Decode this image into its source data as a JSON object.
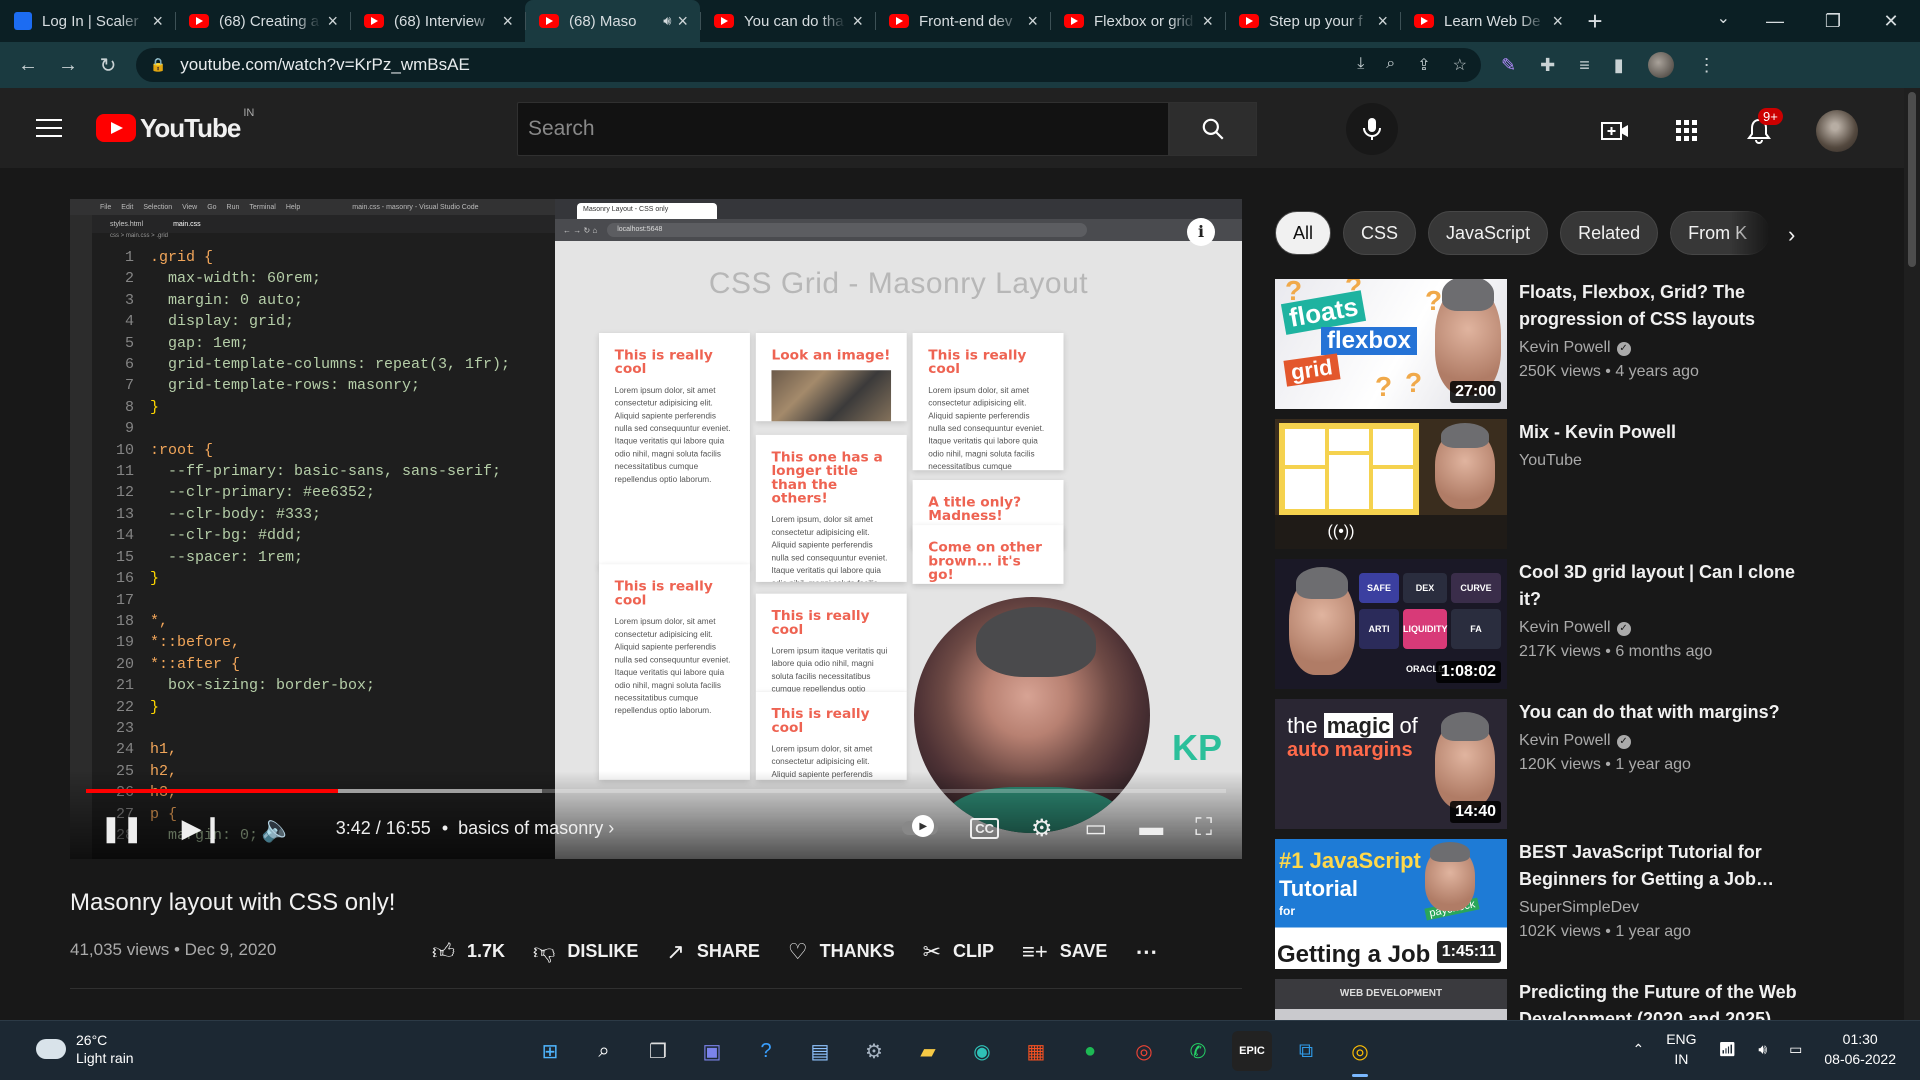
{
  "browser": {
    "tabs": [
      {
        "title": "Log In | Scaler",
        "icon": "scaler-icon",
        "active": false
      },
      {
        "title": "(68) Creating a",
        "icon": "youtube-icon",
        "active": false
      },
      {
        "title": "(68) Interview",
        "icon": "youtube-icon",
        "active": false
      },
      {
        "title": "(68) Maso",
        "icon": "youtube-icon",
        "active": true
      },
      {
        "title": "You can do tha",
        "icon": "youtube-icon",
        "active": false
      },
      {
        "title": "Front-end dev",
        "icon": "youtube-icon",
        "active": false
      },
      {
        "title": "Flexbox or grid",
        "icon": "youtube-icon",
        "active": false
      },
      {
        "title": "Step up your f",
        "icon": "youtube-icon",
        "active": false
      },
      {
        "title": "Learn Web De",
        "icon": "youtube-icon",
        "active": false
      }
    ],
    "url": "youtube.com/watch?v=KrPz_wmBsAE"
  },
  "youtube": {
    "logo_text": "YouTube",
    "region": "IN",
    "search_placeholder": "Search",
    "notification_count": "9+"
  },
  "player": {
    "current_time": "3:42",
    "duration": "16:55",
    "time_display": "3:42 / 16:55",
    "chapter": "basics of masonry",
    "progress_fraction": 0.221,
    "cc_label": "CC",
    "editor": {
      "window_title": "main.css - masonry - Visual Studio Code",
      "menu": [
        "File",
        "Edit",
        "Selection",
        "View",
        "Go",
        "Run",
        "Terminal",
        "Help"
      ],
      "open_files": [
        "styles.html",
        "main.css"
      ],
      "breadcrumb": "css > main.css > .grid",
      "code_lines": [
        ".grid {",
        "  max-width: 60rem;",
        "  margin: 0 auto;",
        "  display: grid;",
        "  gap: 1em;",
        "  grid-template-columns: repeat(3, 1fr);",
        "  grid-template-rows: masonry;",
        "}",
        "",
        ":root {",
        "  --ff-primary: basic-sans, sans-serif;",
        "  --clr-primary: #ee6352;",
        "  --clr-body: #333;",
        "  --clr-bg: #ddd;",
        "  --spacer: 1rem;",
        "}",
        "",
        "*,",
        "*::before,",
        "*::after {",
        "  box-sizing: border-box;",
        "}",
        "",
        "h1,",
        "h2,",
        "h3,",
        "p {",
        "  margin: 0;"
      ]
    },
    "demo": {
      "tab_title": "Masonry Layout - CSS only",
      "address": "localhost:5648",
      "heading": "CSS Grid - Masonry Layout",
      "cards": [
        {
          "title": "This is really cool",
          "body": "Lorem ipsum dolor, sit amet consectetur adipisicing elit. Aliquid sapiente perferendis nulla sed consequuntur eveniet. Itaque veritatis qui labore quia odio nihil, magni soluta facilis necessitatibus cumque repellendus optio laborum."
        },
        {
          "title": "Look an image!",
          "body": ""
        },
        {
          "title": "This is really cool",
          "body": "Lorem ipsum dolor, sit amet consectetur adipisicing elit. Aliquid sapiente perferendis nulla sed consequuntur eveniet. Itaque veritatis qui labore quia odio nihil, magni soluta facilis necessitatibus cumque repellendus optio laborum."
        },
        {
          "title": "This one has a longer title than the others!",
          "body": "Lorem ipsum, dolor sit amet consectetur adipisicing elit. Aliquid sapiente perferendis nulla sed consequuntur eveniet. Itaque veritatis qui labore quia odio nihil, magni soluta facilis necessitatibus cumque repellendus optio laborum."
        },
        {
          "title": "A title only? Madness!",
          "body": ""
        },
        {
          "title": "Come on other brown... it's go!",
          "body": ""
        },
        {
          "title": "This is really cool",
          "body": "Lorem ipsum dolor, sit amet consectetur adipisicing elit. Aliquid sapiente perferendis nulla sed consequuntur eveniet. Itaque veritatis qui labore quia odio nihil, magni soluta facilis necessitatibus cumque repellendus optio laborum."
        },
        {
          "title": "This is really cool",
          "body": "Lorem ipsum itaque veritatis qui labore quia odio nihil, magni soluta facilis necessitatibus cumque repellendus optio laborum."
        },
        {
          "title": "This is really cool",
          "body": "Lorem ipsum dolor, sit amet consectetur adipisicing elit. Aliquid sapiente perferendis nulla sed consequuntur."
        }
      ],
      "watermark": "KP"
    }
  },
  "video": {
    "title": "Masonry layout with CSS only!",
    "views": "41,035 views",
    "date": "Dec 9, 2020",
    "likes": "1.7K",
    "dislike_label": "DISLIKE",
    "share_label": "SHARE",
    "thanks_label": "THANKS",
    "clip_label": "CLIP",
    "save_label": "SAVE"
  },
  "sidebar": {
    "chips": [
      "All",
      "CSS",
      "JavaScript",
      "Related",
      "From K"
    ],
    "recommendations": [
      {
        "title": "Floats, Flexbox, Grid? The progression of CSS layouts",
        "channel": "Kevin Powell",
        "verified": true,
        "stats": "250K views • 4 years ago",
        "duration": "27:00"
      },
      {
        "title": "Mix - Kevin Powell",
        "channel": "YouTube",
        "verified": false,
        "stats": "",
        "duration": ""
      },
      {
        "title": "Cool 3D grid layout | Can I clone it?",
        "channel": "Kevin Powell",
        "verified": true,
        "stats": "217K views • 6 months ago",
        "duration": "1:08:02"
      },
      {
        "title": "You can do that with margins?",
        "channel": "Kevin Powell",
        "verified": true,
        "stats": "120K views • 1 year ago",
        "duration": "14:40"
      },
      {
        "title": "BEST JavaScript Tutorial for Beginners for Getting a Job…",
        "channel": "SuperSimpleDev",
        "verified": false,
        "stats": "102K views • 1 year ago",
        "duration": "1:45:11"
      },
      {
        "title": "Predicting the Future of the Web Development (2020 and 2025)",
        "channel": "",
        "verified": false,
        "stats": "",
        "duration": ""
      }
    ],
    "thumb_text": {
      "t1": [
        "floats",
        "flexbox",
        "grid"
      ],
      "t3": [
        "FA",
        "DEX",
        "CURVE",
        "SAFE",
        "LIQUIDITY ORACLE",
        "ARTI"
      ],
      "t4": [
        "the",
        "magic",
        "of",
        "auto margins"
      ],
      "t5": [
        "#1 JavaScript",
        "Tutorial",
        "for",
        "Getting a Job",
        "paycheck"
      ],
      "t6": "WEB DEVELOPMENT"
    }
  },
  "taskbar": {
    "temperature": "26°C",
    "weather": "Light rain",
    "language": "ENG",
    "region": "IN",
    "time": "01:30",
    "date": "08-06-2022"
  },
  "colors": {
    "youtube_red": "#ff0000",
    "css_accent": "#ee6352",
    "kp_green": "#2bbf9a"
  }
}
